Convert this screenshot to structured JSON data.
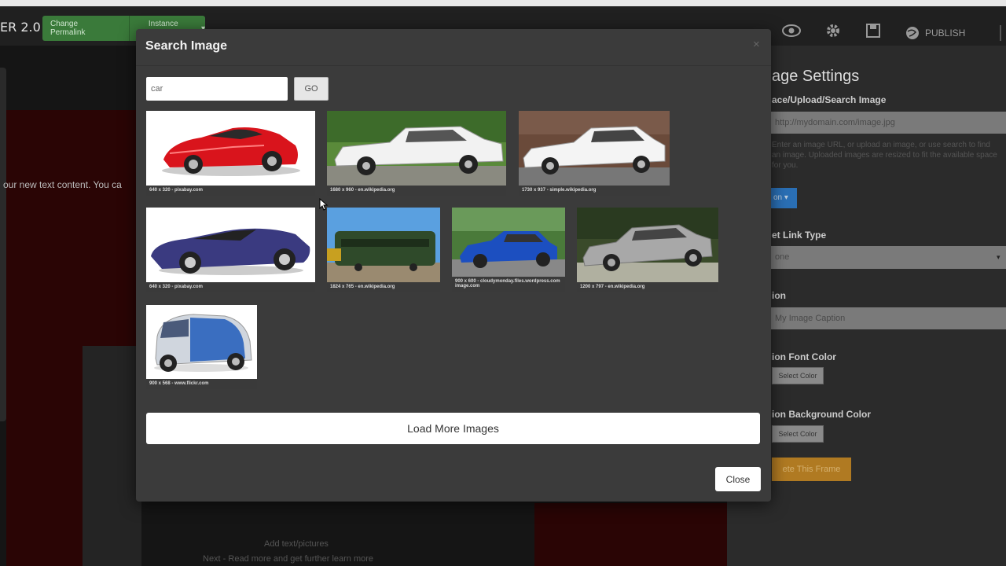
{
  "app": {
    "brand": "ER 2.0",
    "change_button_label": "Change Permalink",
    "change_button_value": "Instance A",
    "nav_publish_label": "PUBLISH"
  },
  "background": {
    "body_text": "our new text content. You ca",
    "footer_line1": "Add text/pictures",
    "footer_line2": "Next - Read more and get further learn more"
  },
  "settings_panel": {
    "title": "age Settings",
    "image_label": "ace/Upload/Search Image",
    "image_url_value": "http://mydomain.com/image.jpg",
    "help_text": "Enter an image URL, or upload an image, or use search to find an image. Uploaded images are resized to fit the available space for you.",
    "button_blue_label": "on",
    "link_type_label": "et Link Type",
    "link_type_value": "one",
    "caption_label": "ion",
    "caption_placeholder": "My Image Caption",
    "caption_font_color_label": "ion Font Color",
    "caption_font_color_button": "Select Color",
    "caption_bg_color_label": "ion Background Color",
    "caption_bg_color_button": "Select Color",
    "orange_button_label": "ete This Frame"
  },
  "modal": {
    "title": "Search Image",
    "close_x": "×",
    "search_value": "car",
    "go_label": "GO",
    "results": [
      {
        "caption": "640 x 320 - pixabay.com",
        "subject": "red sports car"
      },
      {
        "caption": "1680 x 960 - en.wikipedia.org",
        "subject": "white lincoln town car"
      },
      {
        "caption": "1730 x 937 - simple.wikipedia.org",
        "subject": "white lincoln sedan"
      },
      {
        "caption": "640 x 320 - pixabay.com",
        "subject": "blue convertible sports car"
      },
      {
        "caption": "1824 x 765 - en.wikipedia.org",
        "subject": "green railway car"
      },
      {
        "caption": "900 x 600 - cloudymonday.files.wordpress.com",
        "caption2": "image.com",
        "subject": "blue honda sedan"
      },
      {
        "caption": "1200 x 797 - en.wikipedia.org",
        "subject": "silver lincoln sedan"
      },
      {
        "caption": "900 x 568 - www.flickr.com",
        "subject": "blue smart car"
      }
    ],
    "load_more_label": "Load More Images",
    "close_label": "Close"
  }
}
